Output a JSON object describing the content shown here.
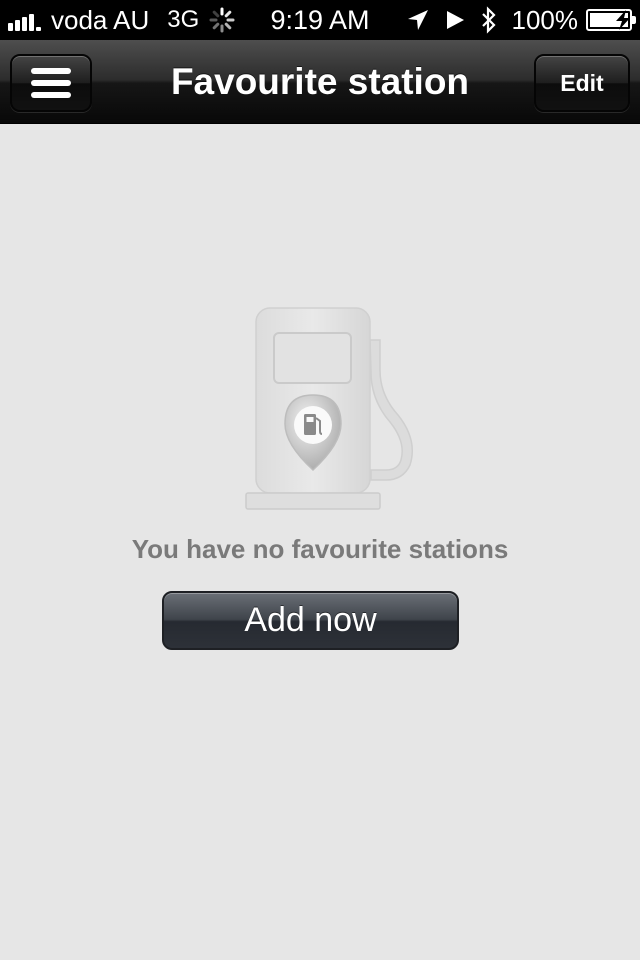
{
  "status_bar": {
    "carrier": "voda AU",
    "network": "3G",
    "time": "9:19 AM",
    "battery": "100%",
    "icons": [
      "signal-icon",
      "activity-spinner-icon",
      "location-arrow-icon",
      "play-icon",
      "bluetooth-icon",
      "battery-icon"
    ]
  },
  "nav": {
    "title": "Favourite station",
    "menu_icon": "hamburger-menu-icon",
    "edit_label": "Edit"
  },
  "content": {
    "illustration": "fuel-pump-icon",
    "empty_message": "You have no favourite stations",
    "add_label": "Add now"
  },
  "colors": {
    "background": "#e6e6e6",
    "message_text": "#7a7a7a",
    "button_dark": "#2d3138"
  }
}
